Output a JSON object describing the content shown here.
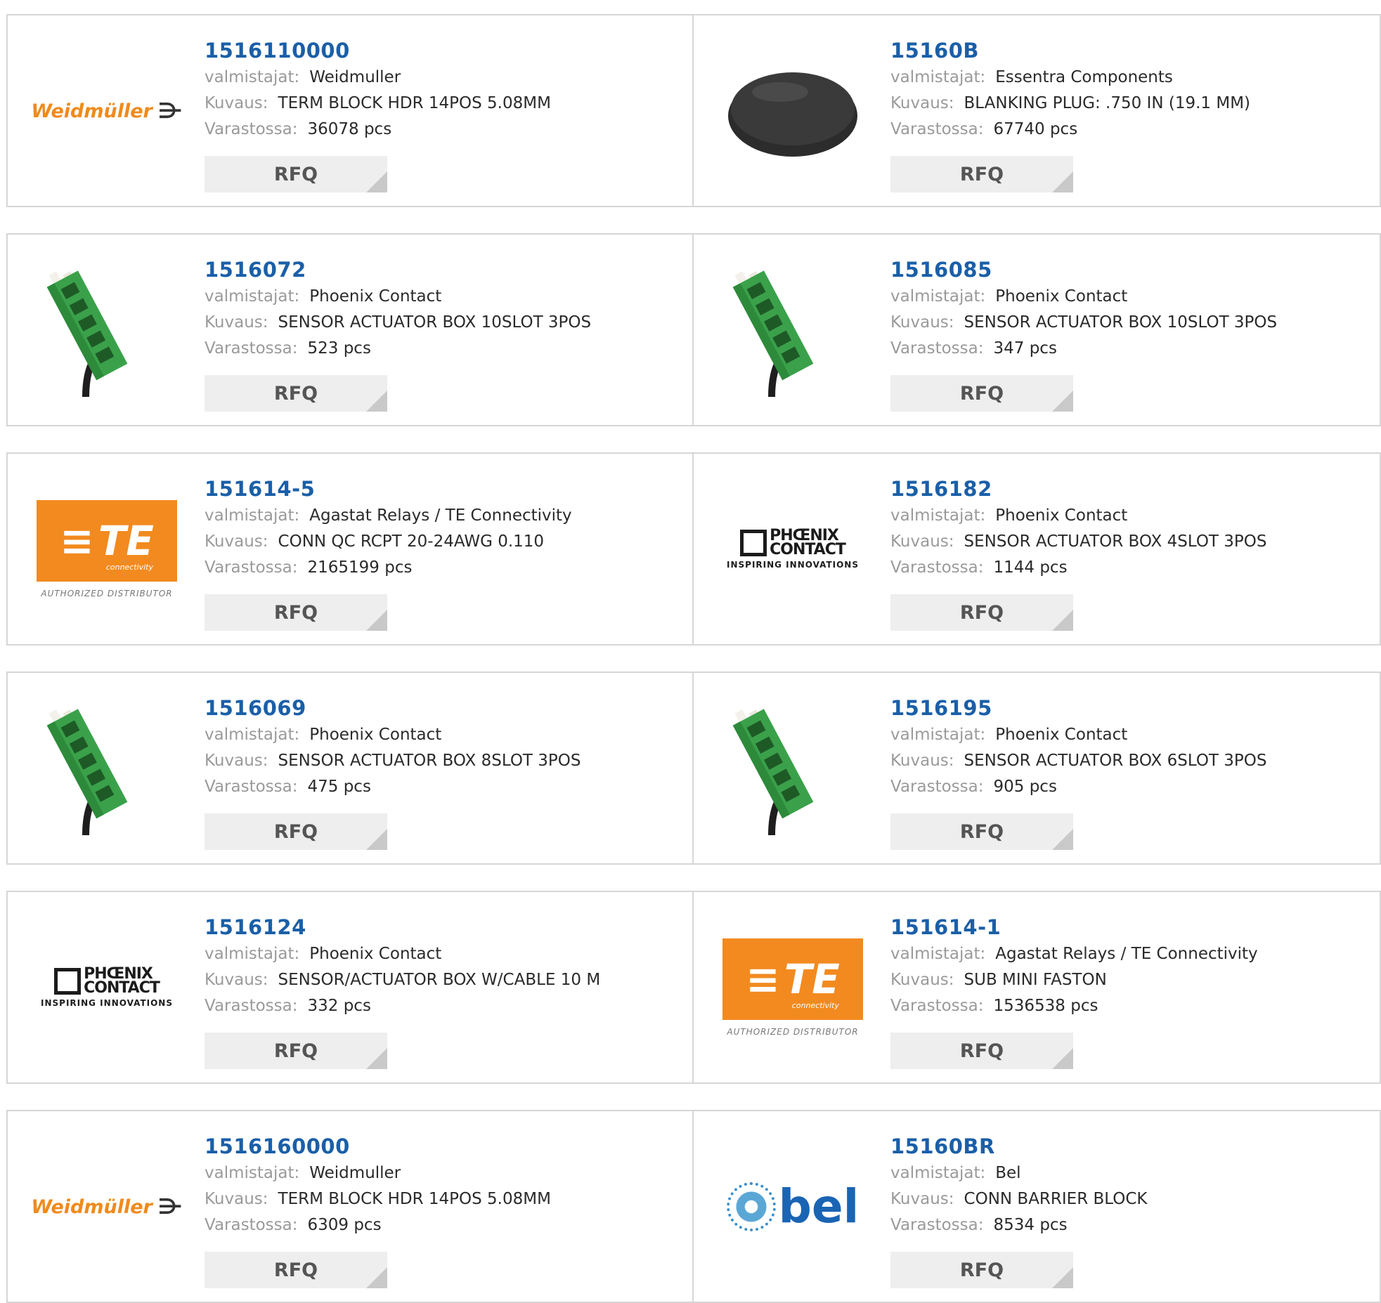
{
  "labels": {
    "manufacturer": "valmistajat:",
    "description": "Kuvaus:",
    "stock": "Varastossa:",
    "rfq": "RFQ"
  },
  "products": [
    {
      "part": "1516110000",
      "manufacturer": "Weidmuller",
      "description": "TERM BLOCK HDR 14POS 5.08MM",
      "stock": "36078 pcs",
      "image": "weidmuller-logo"
    },
    {
      "part": "15160B",
      "manufacturer": "Essentra Components",
      "description": "BLANKING PLUG: .750 IN (19.1 MM)",
      "stock": "67740 pcs",
      "image": "blanking-plug-photo"
    },
    {
      "part": "1516072",
      "manufacturer": "Phoenix Contact",
      "description": "SENSOR ACTUATOR BOX 10SLOT 3POS",
      "stock": "523 pcs",
      "image": "sensor-box-photo"
    },
    {
      "part": "1516085",
      "manufacturer": "Phoenix Contact",
      "description": "SENSOR ACTUATOR BOX 10SLOT 3POS",
      "stock": "347 pcs",
      "image": "sensor-box-photo"
    },
    {
      "part": "151614-5",
      "manufacturer": "Agastat Relays / TE Connectivity",
      "description": "CONN QC RCPT 20-24AWG 0.110",
      "stock": "2165199 pcs",
      "image": "te-logo"
    },
    {
      "part": "1516182",
      "manufacturer": "Phoenix Contact",
      "description": "SENSOR ACTUATOR BOX 4SLOT 3POS",
      "stock": "1144 pcs",
      "image": "phoenix-logo"
    },
    {
      "part": "1516069",
      "manufacturer": "Phoenix Contact",
      "description": "SENSOR ACTUATOR BOX 8SLOT 3POS",
      "stock": "475 pcs",
      "image": "sensor-box-photo"
    },
    {
      "part": "1516195",
      "manufacturer": "Phoenix Contact",
      "description": "SENSOR ACTUATOR BOX 6SLOT 3POS",
      "stock": "905 pcs",
      "image": "sensor-box-photo"
    },
    {
      "part": "1516124",
      "manufacturer": "Phoenix Contact",
      "description": "SENSOR/ACTUATOR BOX W/CABLE 10 M",
      "stock": "332 pcs",
      "image": "phoenix-logo"
    },
    {
      "part": "151614-1",
      "manufacturer": "Agastat Relays / TE Connectivity",
      "description": "SUB MINI FASTON",
      "stock": "1536538 pcs",
      "image": "te-logo"
    },
    {
      "part": "1516160000",
      "manufacturer": "Weidmuller",
      "description": "TERM BLOCK HDR 14POS 5.08MM",
      "stock": "6309 pcs",
      "image": "weidmuller-logo"
    },
    {
      "part": "15160BR",
      "manufacturer": "Bel",
      "description": "CONN BARRIER BLOCK",
      "stock": "8534 pcs",
      "image": "bel-logo"
    }
  ],
  "logos": {
    "weidmuller": "Weidmüller",
    "te_main": "TE",
    "te_sub": "connectivity",
    "te_auth": "AUTHORIZED DISTRIBUTOR",
    "phoenix_line1": "PHŒNIX",
    "phoenix_line2": "CONTACT",
    "phoenix_tag": "INSPIRING INNOVATIONS",
    "bel": "bel"
  }
}
